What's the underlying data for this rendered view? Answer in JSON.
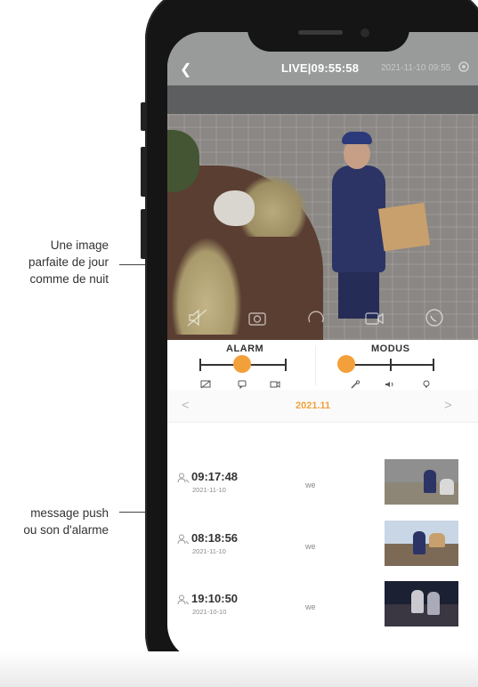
{
  "callouts": {
    "image_quality": "Une image\nparfaite de jour\ncomme de nuit",
    "push_message": "message push\nou son d'alarme"
  },
  "live": {
    "label": "LIVE|09:55:58",
    "date": "2021-11-10 09:55"
  },
  "alarm": {
    "label": "ALARM",
    "level": 0.5
  },
  "modus": {
    "label": "MODUS",
    "level": 0.0
  },
  "month_nav": {
    "prev": "<",
    "current": "2021.11",
    "next": ">"
  },
  "events": [
    {
      "time": "09:17:48",
      "date": "2021-11-10",
      "user": "we"
    },
    {
      "time": "08:18:56",
      "date": "2021-11-10",
      "user": "we"
    },
    {
      "time": "19:10:50",
      "date": "2021-10-10",
      "user": "we"
    }
  ],
  "colors": {
    "accent": "#f4a03a",
    "phone": "#151515",
    "text": "#333333"
  },
  "icons": [
    "back-chevron-icon",
    "settings-icon",
    "mute-icon",
    "camera-icon",
    "record-icon",
    "video-icon",
    "phone-icon",
    "push-icon",
    "alarm-icon",
    "motion-icon",
    "tool-icon",
    "volume-icon",
    "bulb-icon",
    "person-icon"
  ]
}
